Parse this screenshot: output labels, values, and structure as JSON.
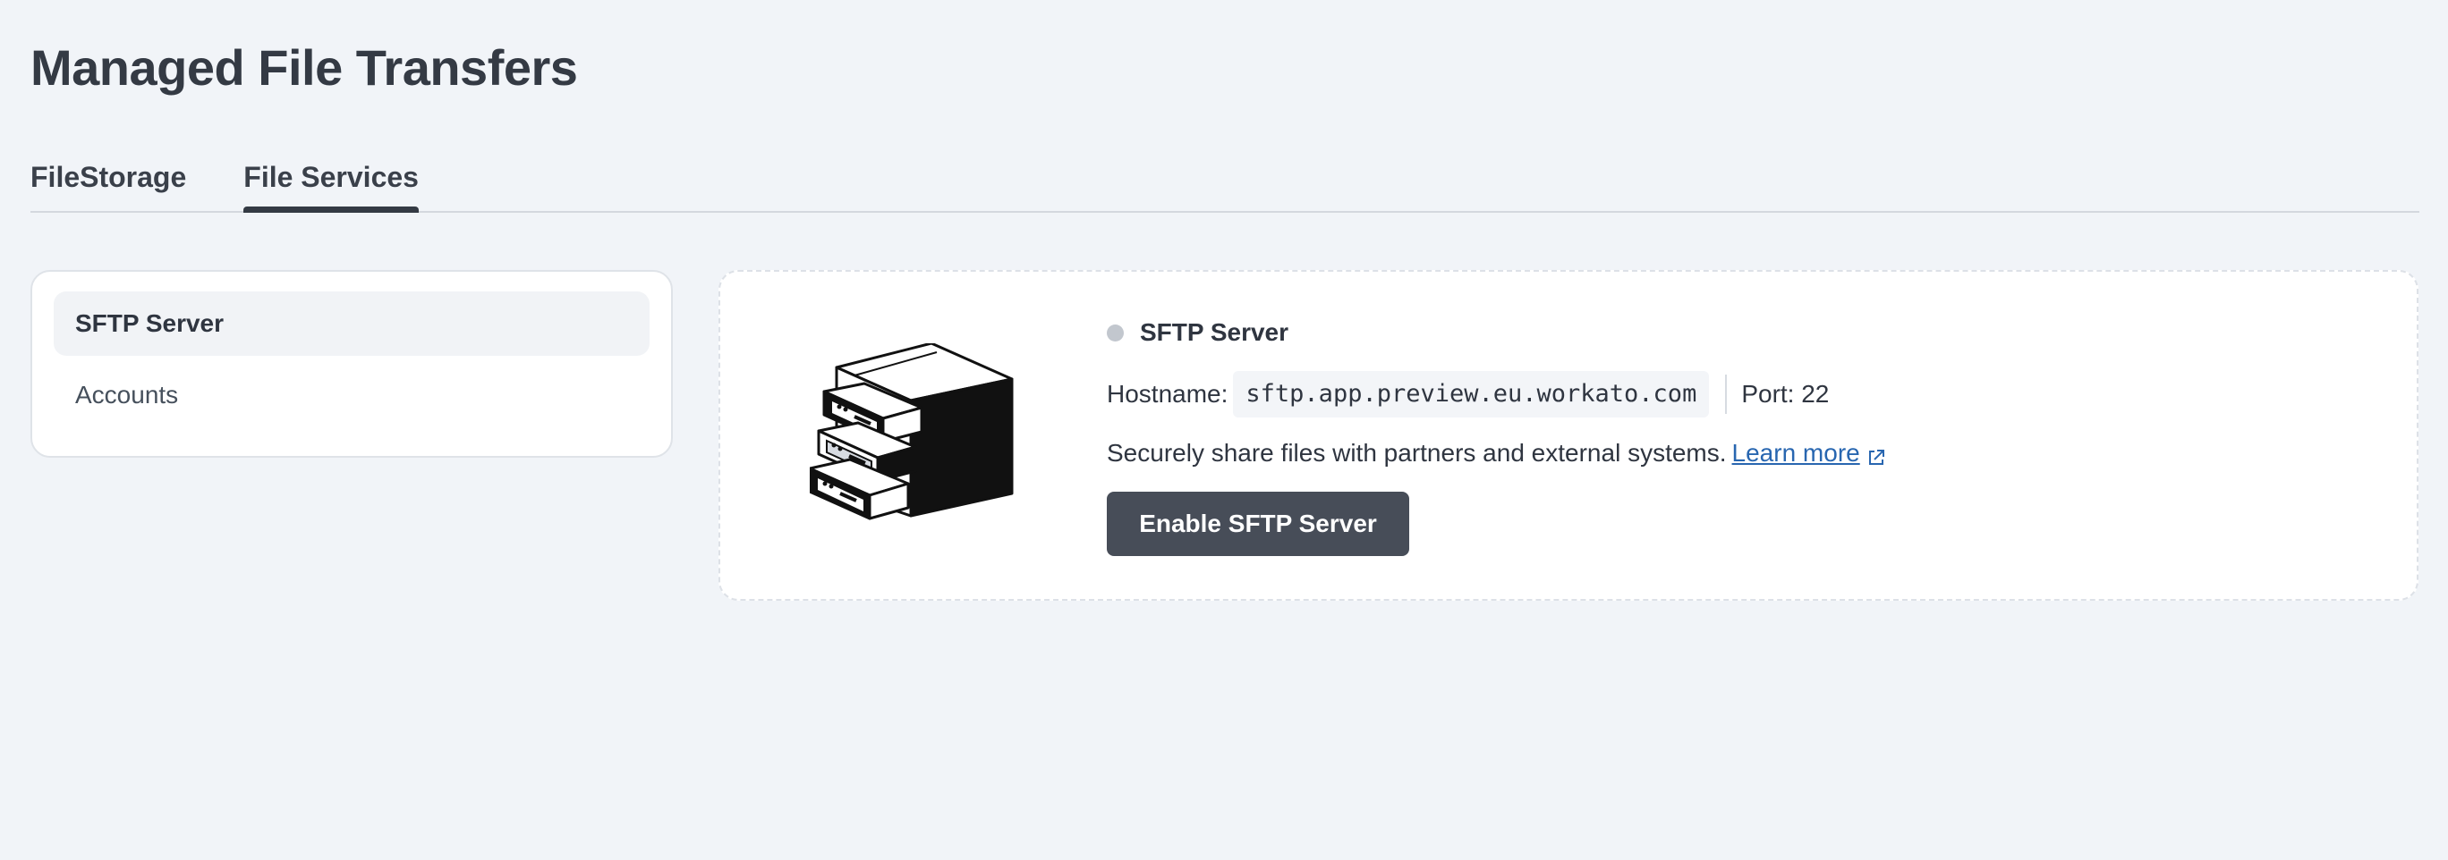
{
  "page": {
    "title": "Managed File Transfers"
  },
  "tabs": [
    {
      "label": "FileStorage",
      "active": false
    },
    {
      "label": "File Services",
      "active": true
    }
  ],
  "sidebar": {
    "items": [
      {
        "label": "SFTP Server",
        "active": true
      },
      {
        "label": "Accounts",
        "active": false
      }
    ]
  },
  "sftp": {
    "status_title": "SFTP Server",
    "status_color": "#c2c7ce",
    "hostname_label": "Hostname:",
    "hostname_value": "sftp.app.preview.eu.workato.com",
    "port_label": "Port: 22",
    "description": "Securely share files with partners and external systems.",
    "learn_more": "Learn more",
    "learn_more_icon": "external-link-icon",
    "enable_button": "Enable SFTP Server",
    "illustration_icon": "file-cabinet-server-icon"
  },
  "colors": {
    "background": "#f1f4f8",
    "primary_button": "#474d58",
    "link": "#2866b0",
    "text": "#2f3540"
  }
}
